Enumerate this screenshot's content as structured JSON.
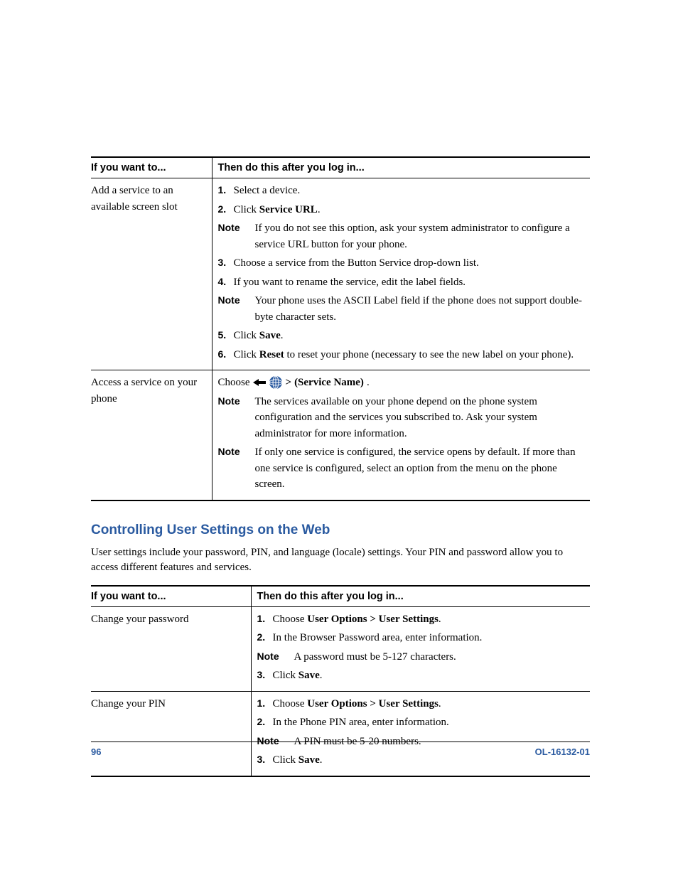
{
  "table1": {
    "headers": {
      "c1": "If you want to...",
      "c2": "Then do this after you log in..."
    },
    "rows": [
      {
        "c1": "Add a service to an available screen slot",
        "steps": {
          "s1_num": "1.",
          "s1_text": "Select a device.",
          "s2_num": "2.",
          "s2_pre": "Click ",
          "s2_b": "Service URL",
          "s2_post": ".",
          "n1_label": "Note",
          "n1_text": "If you do not see this option, ask your system administrator to configure a service URL button for your phone.",
          "s3_num": "3.",
          "s3_text": "Choose a service from the Button Service drop-down list.",
          "s4_num": "4.",
          "s4_text": "If you want to rename the service, edit the label fields.",
          "n2_label": "Note",
          "n2_text": "Your phone uses the ASCII Label field if the phone does not support double-byte character sets.",
          "s5_num": "5.",
          "s5_pre": "Click ",
          "s5_b": "Save",
          "s5_post": ".",
          "s6_num": "6.",
          "s6_pre": "Click ",
          "s6_b": "Reset",
          "s6_post": " to reset your phone (necessary to see the new label on your phone)."
        }
      },
      {
        "c1": "Access a service on your phone",
        "steps": {
          "line_pre": "Choose ",
          "line_mid": " > ",
          "line_b": "(Service Name)",
          "line_post": ".",
          "n1_label": "Note",
          "n1_text": "The services available on your phone depend on the phone system configuration and the services you subscribed to. Ask your system administrator for more information.",
          "n2_label": "Note",
          "n2_text": "If only one service is configured, the service opens by default. If more than one service is configured, select an option from the menu on the phone screen."
        }
      }
    ]
  },
  "section": {
    "heading": "Controlling User Settings on the Web",
    "intro": "User settings include your password, PIN, and language (locale) settings. Your PIN and password allow you to access different features and services."
  },
  "table2": {
    "headers": {
      "c1": "If you want to...",
      "c2": "Then do this after you log in..."
    },
    "rows": [
      {
        "c1": "Change your password",
        "steps": {
          "s1_num": "1.",
          "s1_pre": "Choose ",
          "s1_b": "User Options > User Settings",
          "s1_post": ".",
          "s2_num": "2.",
          "s2_text": "In the Browser Password area, enter information.",
          "n1_label": "Note",
          "n1_text": "A password must be 5-127 characters.",
          "s3_num": "3.",
          "s3_pre": "Click ",
          "s3_b": "Save",
          "s3_post": "."
        }
      },
      {
        "c1": "Change your PIN",
        "steps": {
          "s1_num": "1.",
          "s1_pre": "Choose ",
          "s1_b": "User Options > User Settings",
          "s1_post": ".",
          "s2_num": "2.",
          "s2_text": "In the Phone PIN area, enter information.",
          "n1_label": "Note",
          "n1_text": "A PIN must be 5-20 numbers.",
          "s3_num": "3.",
          "s3_pre": "Click ",
          "s3_b": "Save",
          "s3_post": "."
        }
      }
    ]
  },
  "footer": {
    "page": "96",
    "doc": "OL-16132-01"
  }
}
